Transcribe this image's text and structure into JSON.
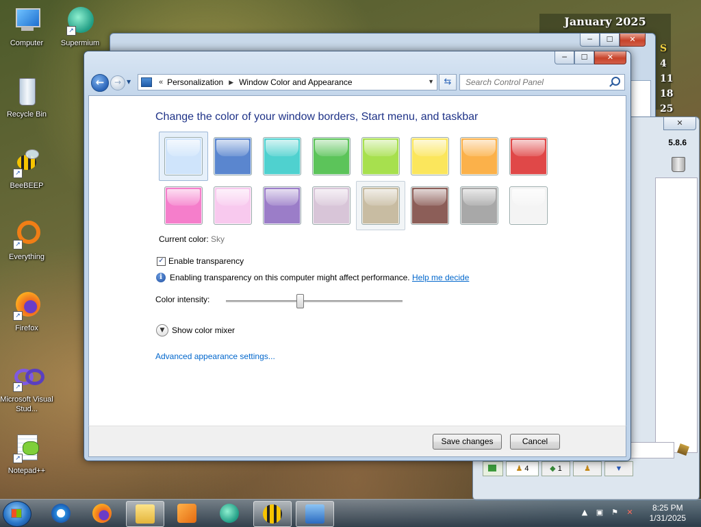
{
  "desktop": {
    "icons": [
      {
        "label": "Computer"
      },
      {
        "label": "Supermium"
      },
      {
        "label": "Recycle Bin"
      },
      {
        "label": "BeeBEEP"
      },
      {
        "label": "Everything"
      },
      {
        "label": "Firefox"
      },
      {
        "label": "Microsoft Visual Stud..."
      },
      {
        "label": "Notepad++"
      }
    ]
  },
  "calendar": {
    "title": "January 2025",
    "visible_days": [
      "S",
      "4",
      "11",
      "18",
      "25"
    ]
  },
  "side_app": {
    "version": "5.8.6",
    "tab_counts": [
      "4",
      "1"
    ]
  },
  "window": {
    "caption": {
      "minimize": "─",
      "maximize": "☐",
      "close": "✕"
    },
    "address": {
      "overflow": "«",
      "crumbs": [
        "Personalization",
        "Window Color and Appearance"
      ]
    },
    "search_placeholder": "Search Control Panel",
    "heading": "Change the color of your window borders, Start menu, and taskbar",
    "colors_row1": [
      "#cfe4fb",
      "#5a86cf",
      "#4fd1cf",
      "#5cc45a",
      "#a7e04e",
      "#fbe65c",
      "#fbb14a",
      "#e04848"
    ],
    "colors_row2": [
      "#f57ecb",
      "#f8c9ee",
      "#9b7dc8",
      "#d8c5d8",
      "#c8bca2",
      "#8c5e58",
      "#a8a8a8",
      "#f4f4f4"
    ],
    "current_color_label": "Current color:",
    "current_color_value": "Sky",
    "enable_transparency": "Enable transparency",
    "info_text": "Enabling transparency on this computer might affect performance.",
    "help_link": "Help me decide",
    "intensity_label": "Color intensity:",
    "intensity_value": 0.42,
    "show_mixer": "Show color mixer",
    "advanced_link": "Advanced appearance settings...",
    "save": "Save changes",
    "cancel": "Cancel"
  },
  "taskbar": {
    "time": "8:25 PM",
    "date": "1/31/2025"
  }
}
